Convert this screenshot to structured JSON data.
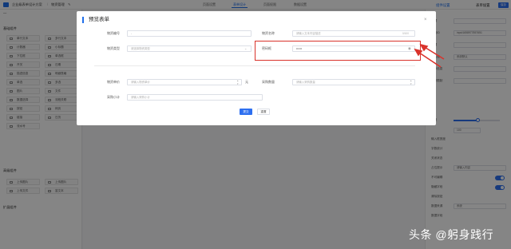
{
  "topbar": {
    "breadcrumb_app": "企业级表单设计方案",
    "breadcrumb_sep": "/",
    "breadcrumb_page": "物资管理",
    "tabs": [
      "页面设置",
      "表单设计",
      "页面权限",
      "数据设置"
    ],
    "active_tab": "表单设计",
    "save_label": "保存"
  },
  "left_panel": {
    "basic_title": "基础组件",
    "basic_items": [
      "单行文本",
      "多行文本",
      "计数器",
      "小标题",
      "下拉框",
      "单选框",
      "开关",
      "日期",
      "描述信息",
      "明细表格",
      "单选",
      "多选",
      "图片",
      "文件",
      "数据选择",
      "流程关联",
      "按钮",
      "网页",
      "链接",
      "日历",
      "流水号"
    ],
    "adv_title": "高级组件",
    "adv_items": [
      "上传图片",
      "上传图片",
      "上传文件",
      "富文本"
    ],
    "ext_title": "扩展组件"
  },
  "right_panel": {
    "tabs": [
      "组件设置",
      "表单设置"
    ],
    "rows": [
      {
        "label": "标题",
        "value": ""
      },
      {
        "label": "字段ID",
        "value": "input1658977857651"
      },
      {
        "label": "标题",
        "value": ""
      },
      {
        "label": "默认值",
        "value": "系统默认"
      },
      {
        "label": "提示信息",
        "value": ""
      },
      {
        "label": "字符限制",
        "value": ""
      }
    ],
    "width_label": "宽度",
    "width_value": "100",
    "extra_labels": [
      "输入框宽度",
      "字数统计",
      "关闭状态",
      "占位提示",
      "不可编辑",
      "隐藏字段",
      "清除按钮",
      "数据来源",
      "数据字段"
    ],
    "placeholder_value": "请输入内容",
    "source_value": "系统"
  },
  "modal": {
    "title": "预览表单",
    "close_icon_char": "×",
    "fields": {
      "code_label": "物资编号",
      "code_value": "-",
      "name_label": "物资名称",
      "name_placeholder": "请输入文本内容描述",
      "name_counter": "0/100",
      "type_label": "物资类型",
      "type_placeholder": "请选择物资类型",
      "password_label": "密码框",
      "password_value": "••••••",
      "price_label": "物资单价",
      "price_placeholder": "请输入物资单价",
      "price_unit": "元",
      "qty_label": "采购数量",
      "qty_placeholder": "请输入采购数量",
      "subtotal_label": "采购小计",
      "subtotal_placeholder": "请输入采购小计"
    },
    "ok_label": "提交",
    "reset_label": "重置"
  },
  "watermark": "头条 @躬身践行",
  "colors": {
    "accent": "#2d6ff0",
    "highlight": "#d9322b",
    "overlay": "rgba(0,0,0,0.48)"
  }
}
